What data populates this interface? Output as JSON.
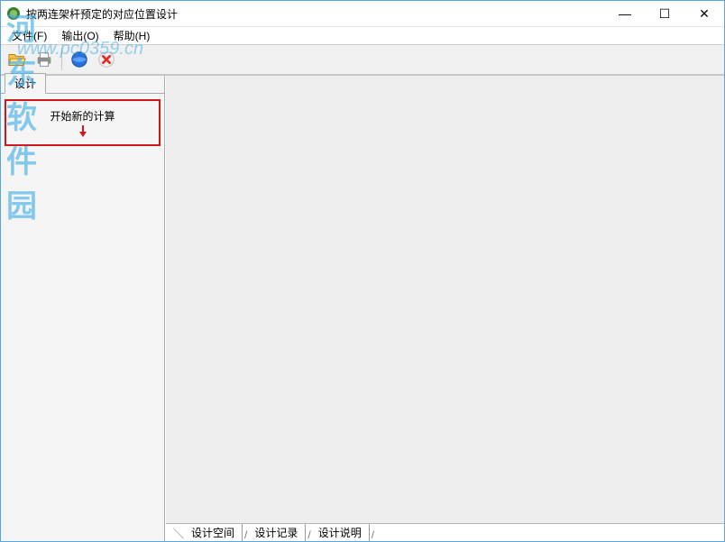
{
  "window": {
    "title": "按两连架杆预定的对应位置设计"
  },
  "menubar": {
    "file": "文件(F)",
    "output": "输出(O)",
    "help": "帮助(H)"
  },
  "toolbar": {
    "open_icon": "open-file-icon",
    "print_icon": "print-icon",
    "globe_icon": "globe-icon",
    "delete_icon": "delete-icon"
  },
  "side": {
    "tab_label": "设计",
    "new_calc_label": "开始新的计算",
    "arrow_icon": "arrow-down-red-icon"
  },
  "bottom_tabs": {
    "t1": "设计空间",
    "t2": "设计记录",
    "t3": "设计说明"
  },
  "watermark": {
    "brand": "河东软件园",
    "url": "www.pc0359.cn"
  }
}
